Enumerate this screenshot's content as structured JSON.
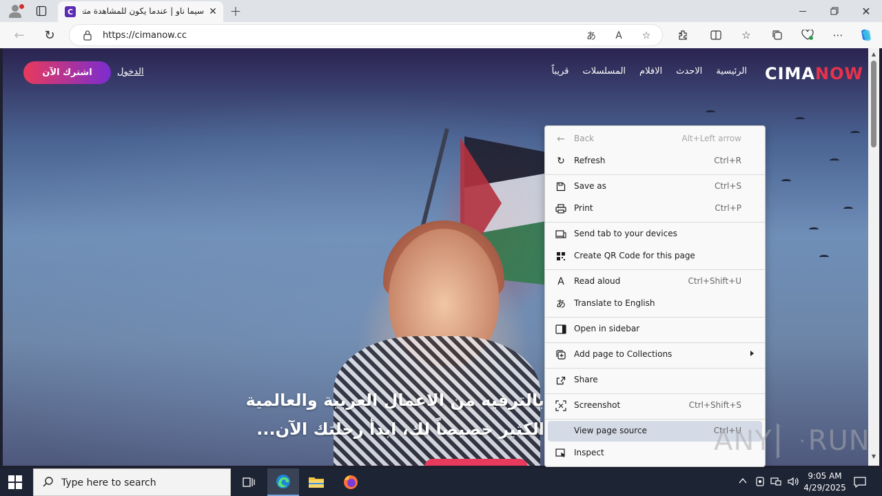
{
  "browser": {
    "tab_title": "سيما ناو | عندما يكون للمشاهدة متعة",
    "favicon_letter": "C",
    "url": "https://cimanow.cc"
  },
  "site": {
    "logo_prefix": "CIMA",
    "logo_suffix": "NOW",
    "nav": [
      "الرئيسية",
      "الاحدث",
      "الافلام",
      "المسلسلات",
      "قريباً"
    ],
    "login": "الدخول",
    "subscribe": "اشترك الآن",
    "hero_line1": "بالترفيه من الاعمال العربية والعالمية",
    "hero_line2": "الكثير خصيصاً لك، ابدأ رحلتك الآن..."
  },
  "context_menu": {
    "items": [
      {
        "label": "Back",
        "shortcut": "Alt+Left arrow",
        "icon": "back-arrow-icon"
      },
      {
        "label": "Refresh",
        "shortcut": "Ctrl+R",
        "icon": "refresh-icon"
      },
      {
        "label": "Save as",
        "shortcut": "Ctrl+S",
        "icon": "save-icon"
      },
      {
        "label": "Print",
        "shortcut": "Ctrl+P",
        "icon": "print-icon"
      },
      {
        "label": "Send tab to your devices",
        "shortcut": "",
        "icon": "devices-icon"
      },
      {
        "label": "Create QR Code for this page",
        "shortcut": "",
        "icon": "qr-code-icon"
      },
      {
        "label": "Read aloud",
        "shortcut": "Ctrl+Shift+U",
        "icon": "read-aloud-icon"
      },
      {
        "label": "Translate to English",
        "shortcut": "",
        "icon": "translate-icon"
      },
      {
        "label": "Open in sidebar",
        "shortcut": "",
        "icon": "sidebar-icon"
      },
      {
        "label": "Add page to Collections",
        "shortcut": "",
        "icon": "collections-icon"
      },
      {
        "label": "Share",
        "shortcut": "",
        "icon": "share-icon"
      },
      {
        "label": "Screenshot",
        "shortcut": "Ctrl+Shift+S",
        "icon": "screenshot-icon"
      },
      {
        "label": "View page source",
        "shortcut": "Ctrl+U",
        "icon": ""
      },
      {
        "label": "Inspect",
        "shortcut": "",
        "icon": "inspect-icon"
      }
    ]
  },
  "watermark": {
    "left": "ANY",
    "right": "RUN"
  },
  "taskbar": {
    "search_placeholder": "Type here to search",
    "time": "9:05 AM",
    "date": "4/29/2025"
  },
  "colors": {
    "accent": "#e8324c",
    "brand_purple": "#5b2bb3",
    "menu_highlight": "#d5dbe6"
  }
}
